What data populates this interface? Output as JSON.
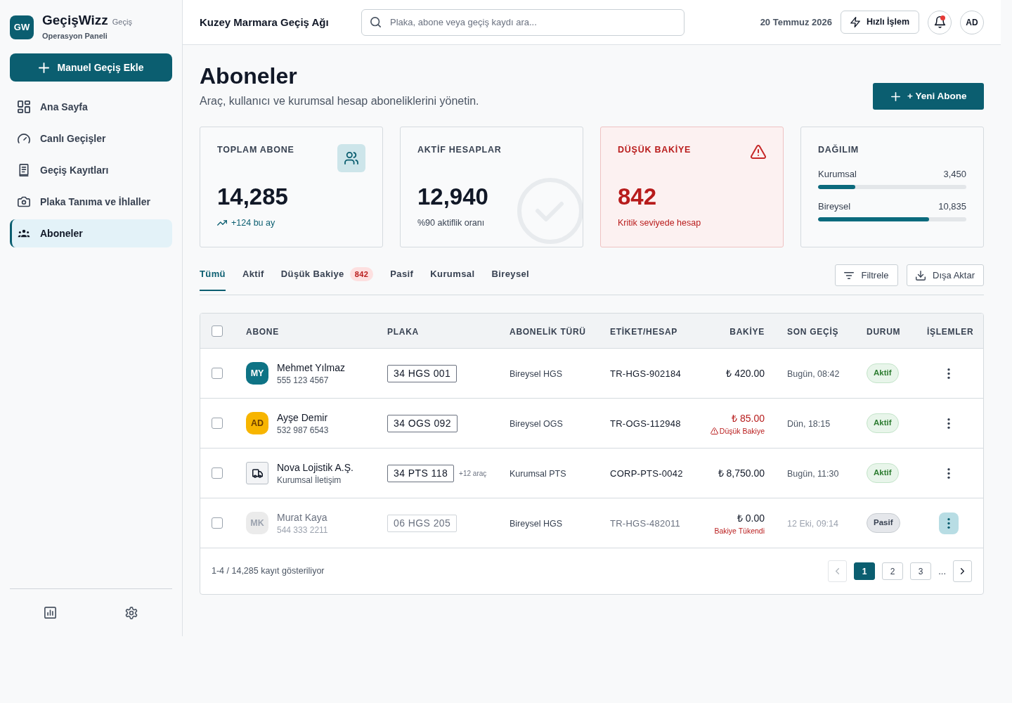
{
  "sidebar": {
    "logo": {
      "initials": "GW",
      "name": "GeçişWizz",
      "tagline": "Geçiş",
      "subtitle": "Operasyon Paneli"
    },
    "add_button": {
      "label": "Manuel Geçiş Ekle"
    },
    "nav": [
      {
        "label": "Ana Sayfa",
        "selected": false
      },
      {
        "label": "Canlı Geçişler",
        "selected": false
      },
      {
        "label": "Geçiş Kayıtları",
        "selected": false
      },
      {
        "label": "Plaka Tanıma ve İhlaller",
        "selected": false
      },
      {
        "label": "Aboneler",
        "selected": true
      }
    ]
  },
  "header": {
    "title": "Kuzey Marmara Geçiş Ağı",
    "search": {
      "placeholder": "Plaka, abone veya geçiş kaydı ara..."
    },
    "date": "20 Temmuz 2026",
    "quick_action": {
      "label": "Hızlı İşlem"
    },
    "notifications": {
      "unread": true
    },
    "user": {
      "initials": "AD"
    }
  },
  "page": {
    "title": "Aboneler",
    "subtitle": "Araç, kullanıcı ve kurumsal hesap aboneliklerini yönetin.",
    "new_button": {
      "label": "+ Yeni Abone"
    }
  },
  "stats": [
    {
      "kind": "total",
      "label": "TOPLAM ABONE",
      "value": "14,285",
      "note": "+124 bu ay"
    },
    {
      "kind": "active",
      "label": "AKTİF HESAPLAR",
      "value": "12,940",
      "note": "%90 aktiflik oranı"
    },
    {
      "kind": "alert",
      "label": "DÜŞÜK BAKİYE",
      "value": "842",
      "note": "Kritik seviyede hesap"
    },
    {
      "kind": "distribution",
      "label": "DAĞILIM",
      "items": [
        {
          "label": "Kurumsal",
          "value": "3,450",
          "level": 0.25
        },
        {
          "label": "Bireysel",
          "value": "10,835",
          "level": 0.75
        }
      ]
    }
  ],
  "tabs": [
    {
      "label": "Tümü",
      "selected": true
    },
    {
      "label": "Aktif",
      "selected": false
    },
    {
      "label": "Düşük Bakiye",
      "selected": false,
      "badge": "842"
    },
    {
      "label": "Pasif",
      "selected": false
    },
    {
      "label": "Kurumsal",
      "selected": false
    },
    {
      "label": "Bireysel",
      "selected": false
    }
  ],
  "toolbar": {
    "filter": {
      "label": "Filtrele"
    },
    "export": {
      "label": "Dışa Aktar"
    }
  },
  "table": {
    "select_all": {
      "checked": false
    },
    "columns": [
      "ABONE",
      "PLAKA",
      "ABONELİK TÜRÜ",
      "ETİKET/HESAP",
      "BAKİYE",
      "SON GEÇİŞ",
      "DURUM",
      "İŞLEMLER"
    ],
    "rows": [
      {
        "selected": false,
        "active": true,
        "avatar": {
          "kind": "initials",
          "text": "MY",
          "color": "#0e7385"
        },
        "name": "Mehmet Yılmaz",
        "contact": "555 123 4567",
        "plate": "34 HGS 001",
        "type": "Bireysel HGS",
        "tag": "TR-HGS-902184",
        "balance": {
          "kind": "ok",
          "amount": "₺ 420.00"
        },
        "last_pass": "Bugün, 08:42",
        "status": "Aktif",
        "actions_active": false
      },
      {
        "selected": false,
        "active": true,
        "avatar": {
          "kind": "initials",
          "text": "AD",
          "color": "#f7b500"
        },
        "name": "Ayşe Demir",
        "contact": "532 987 6543",
        "plate": "34 OGS 092",
        "type": "Bireysel OGS",
        "tag": "TR-OGS-112948",
        "balance": {
          "kind": "low",
          "amount": "₺ 85.00",
          "note": "Düşük Bakiye"
        },
        "last_pass": "Dün, 18:15",
        "status": "Aktif",
        "actions_active": false
      },
      {
        "selected": false,
        "active": true,
        "avatar": {
          "kind": "icon"
        },
        "name": "Nova Lojistik A.Ş.",
        "contact": "Kurumsal İletişim",
        "plate": "34 PTS 118",
        "plate_extra": "+12 araç",
        "type": "Kurumsal PTS",
        "tag": "CORP-PTS-0042",
        "balance": {
          "kind": "ok",
          "amount": "₺ 8,750.00"
        },
        "last_pass": "Bugün, 11:30",
        "status": "Aktif",
        "actions_active": false
      },
      {
        "selected": false,
        "active": false,
        "avatar": {
          "kind": "initials",
          "text": "MK",
          "color": "#ebebeb"
        },
        "name": "Murat Kaya",
        "contact": "544 333 2211",
        "plate": "06 HGS 205",
        "type": "Bireysel HGS",
        "tag": "TR-HGS-482011",
        "balance": {
          "kind": "empty",
          "amount": "₺ 0.00",
          "note": "Bakiye Tükendi"
        },
        "last_pass": "12 Eki, 09:14",
        "status": "Pasif",
        "actions_active": true
      }
    ]
  },
  "pagination": {
    "summary": "1-4 / 14,285 kayıt gösteriliyor",
    "prev": {
      "disabled": true
    },
    "pages": [
      {
        "label": "1",
        "selected": true
      },
      {
        "label": "2",
        "selected": false
      },
      {
        "label": "3",
        "selected": false
      }
    ],
    "ellipsis": "...",
    "next": {
      "disabled": false
    }
  }
}
